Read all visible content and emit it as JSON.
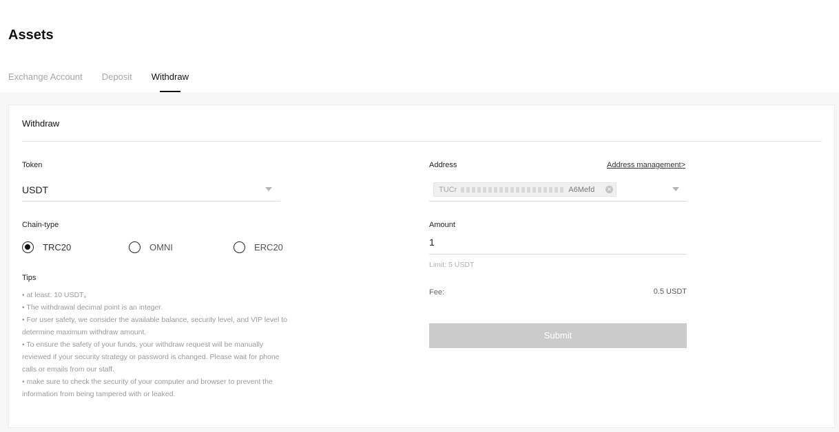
{
  "page": {
    "title": "Assets"
  },
  "tabs": [
    {
      "label": "Exchange Account",
      "active": false
    },
    {
      "label": "Deposit",
      "active": false
    },
    {
      "label": "Withdraw",
      "active": true
    }
  ],
  "withdraw": {
    "title": "Withdraw",
    "token": {
      "label": "Token",
      "value": "USDT"
    },
    "chain_type": {
      "label": "Chain-type",
      "options": [
        {
          "label": "TRC20",
          "checked": true
        },
        {
          "label": "OMNI",
          "checked": false
        },
        {
          "label": "ERC20",
          "checked": false
        }
      ]
    },
    "tips": {
      "label": "Tips",
      "items": [
        "• at least: 10 USDT。",
        "• The withdrawal decimal point is an integer.",
        "• For user safety, we consider the available balance, security level, and VIP level to determine maximum withdraw amount.",
        "• To ensure the safety of your funds, your withdraw request will be manually reviewed if your security strategy or password is changed. Please wait for phone calls or emails from our staff.",
        "• make sure to check the security of your computer and browser to prevent the information from being tampered with or leaked."
      ]
    },
    "address": {
      "label": "Address",
      "management_link": "Address management>",
      "value_prefix": "TUCr",
      "value_suffix": "A6Mefd"
    },
    "amount": {
      "label": "Amount",
      "value": "1",
      "limit": "Limit: 5 USDT"
    },
    "fee": {
      "label": "Fee:",
      "value": "0.5 USDT"
    },
    "submit_label": "Submit"
  },
  "colors": {
    "submit_disabled": "#cbcbcb",
    "tab_active": "#111111",
    "tab_inactive": "#a6a6a6"
  }
}
